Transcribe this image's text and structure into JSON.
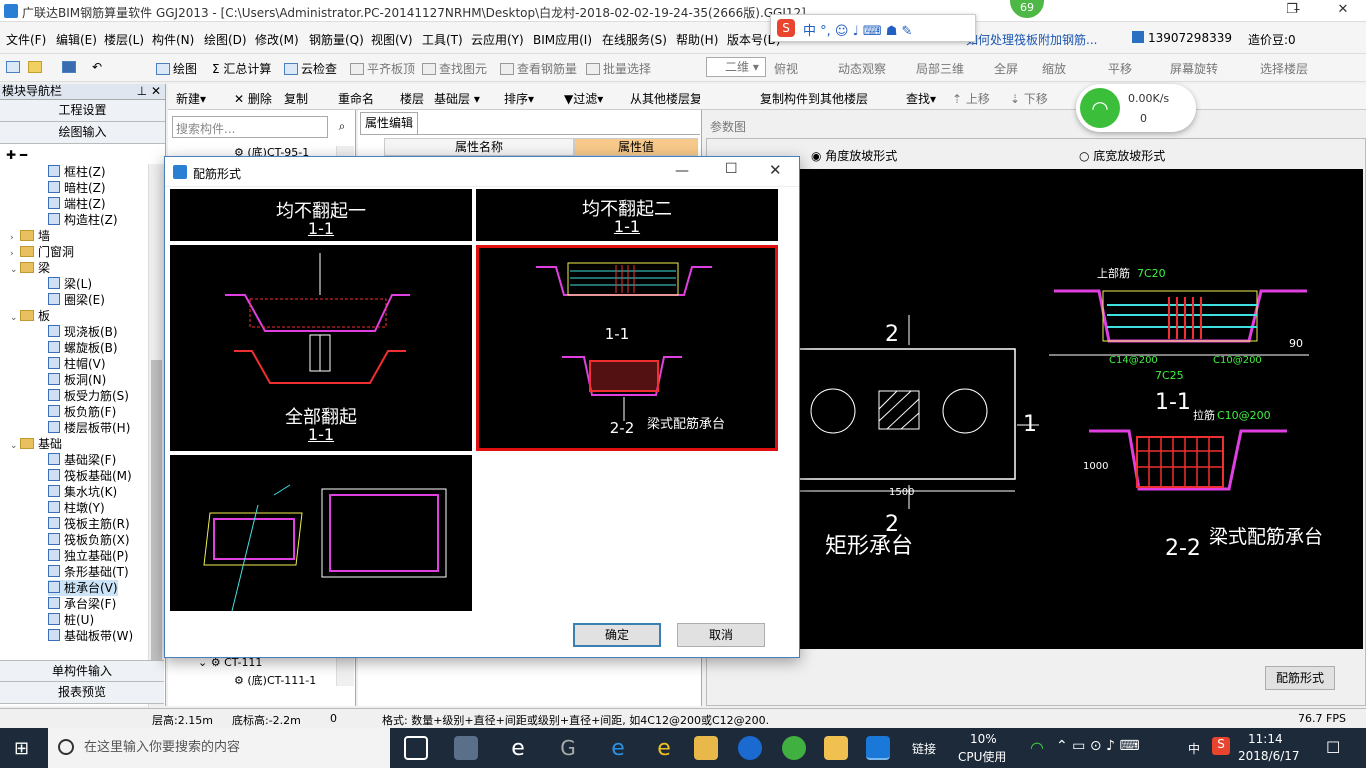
{
  "window": {
    "title": "广联达BIM钢筋算量软件 GGJ2013 - [C:\\Users\\Administrator.PC-20141127NRHM\\Desktop\\白龙村-2018-02-02-19-24-35(2666版).GGJ12]",
    "badge": "69"
  },
  "menu": [
    "文件(F)",
    "编辑(E)",
    "楼层(L)",
    "构件(N)",
    "绘图(D)",
    "修改(M)",
    "钢筋量(Q)",
    "视图(V)",
    "工具(T)",
    "云应用(Y)",
    "BIM应用(I)",
    "在线服务(S)",
    "帮助(H)",
    "版本号(B)"
  ],
  "menu_extra": {
    "notice": "如何处理筏板附加钢筋...",
    "phone": "13907298339",
    "beans": "造价豆:0"
  },
  "toolbar1": [
    "绘图",
    "汇总计算",
    "云检查",
    "平齐板顶",
    "查找图元",
    "查看钢筋量",
    "批量选择",
    "二维",
    "俯视",
    "动态观察",
    "局部三维",
    "全屏",
    "缩放",
    "平移",
    "屏幕旋转",
    "选择楼层"
  ],
  "nav": {
    "title": "模块导航栏",
    "btn_settings": "工程设置",
    "btn_draw": "绘图输入",
    "items": [
      {
        "label": "框柱(Z)",
        "indent": 2,
        "icon": "column-icon"
      },
      {
        "label": "暗柱(Z)",
        "indent": 2,
        "icon": "column-icon"
      },
      {
        "label": "端柱(Z)",
        "indent": 2,
        "icon": "column-icon"
      },
      {
        "label": "构造柱(Z)",
        "indent": 2,
        "icon": "column-icon"
      },
      {
        "label": "墙",
        "indent": 0,
        "icon": "folder-icon",
        "arrow": "›"
      },
      {
        "label": "门窗洞",
        "indent": 0,
        "icon": "folder-icon",
        "arrow": "›"
      },
      {
        "label": "梁",
        "indent": 0,
        "icon": "folder-icon",
        "arrow": "⌄"
      },
      {
        "label": "梁(L)",
        "indent": 2,
        "icon": "beam-icon"
      },
      {
        "label": "圈梁(E)",
        "indent": 2,
        "icon": "beam-icon"
      },
      {
        "label": "板",
        "indent": 0,
        "icon": "folder-icon",
        "arrow": "⌄"
      },
      {
        "label": "现浇板(B)",
        "indent": 2,
        "icon": "slab-icon"
      },
      {
        "label": "螺旋板(B)",
        "indent": 2,
        "icon": "slab-icon"
      },
      {
        "label": "柱帽(V)",
        "indent": 2,
        "icon": "slab-icon"
      },
      {
        "label": "板洞(N)",
        "indent": 2,
        "icon": "slab-icon"
      },
      {
        "label": "板受力筋(S)",
        "indent": 2,
        "icon": "slab-icon"
      },
      {
        "label": "板负筋(F)",
        "indent": 2,
        "icon": "slab-icon"
      },
      {
        "label": "楼层板带(H)",
        "indent": 2,
        "icon": "slab-icon"
      },
      {
        "label": "基础",
        "indent": 0,
        "icon": "folder-icon",
        "arrow": "⌄"
      },
      {
        "label": "基础梁(F)",
        "indent": 2,
        "icon": "foundation-icon"
      },
      {
        "label": "筏板基础(M)",
        "indent": 2,
        "icon": "foundation-icon"
      },
      {
        "label": "集水坑(K)",
        "indent": 2,
        "icon": "foundation-icon"
      },
      {
        "label": "柱墩(Y)",
        "indent": 2,
        "icon": "foundation-icon"
      },
      {
        "label": "筏板主筋(R)",
        "indent": 2,
        "icon": "foundation-icon"
      },
      {
        "label": "筏板负筋(X)",
        "indent": 2,
        "icon": "foundation-icon"
      },
      {
        "label": "独立基础(P)",
        "indent": 2,
        "icon": "foundation-icon"
      },
      {
        "label": "条形基础(T)",
        "indent": 2,
        "icon": "foundation-icon"
      },
      {
        "label": "桩承台(V)",
        "indent": 2,
        "icon": "foundation-icon",
        "selected": true
      },
      {
        "label": "承台梁(F)",
        "indent": 2,
        "icon": "foundation-icon"
      },
      {
        "label": "桩(U)",
        "indent": 2,
        "icon": "foundation-icon"
      },
      {
        "label": "基础板带(W)",
        "indent": 2,
        "icon": "foundation-icon"
      }
    ],
    "btn_single": "单构件输入",
    "btn_report": "报表预览"
  },
  "toolbar2": [
    "新建",
    "删除",
    "复制",
    "重命名",
    "楼层",
    "基础层",
    "排序",
    "过滤",
    "从其他楼层复制构件",
    "复制构件到其他楼层",
    "查找",
    "上移",
    "下移"
  ],
  "components": {
    "search_placeholder": "搜索构件...",
    "top_item": "(底)CT-95-1",
    "bottom_item1": "CT-111",
    "bottom_item2": "(底)CT-111-1"
  },
  "props": {
    "tab": "属性编辑",
    "col_name": "属性名称",
    "col_value": "属性值"
  },
  "param": {
    "header": "参数图",
    "radio1": "角度放坡形式",
    "radio2": "底宽放坡形式",
    "button": "配筋形式",
    "cad": {
      "title_rect": "矩形承台",
      "title_beam": "梁式配筋承台",
      "sec11": "1-1",
      "sec22": "2-2",
      "two": "2",
      "one": "1",
      "dim": "1500",
      "top_bar": "7C20",
      "bot_bar": "7C25",
      "side_bar": "C14@200",
      "stirrup": "C10@200",
      "tie": "C10@200",
      "height": "1000",
      "angle": "90"
    }
  },
  "dialog": {
    "title": "配筋形式",
    "tile1": "均不翻起一",
    "tile1_sec": "1-1",
    "tile2": "均不翻起二",
    "tile2_sec": "1-1",
    "tile3": "全部翻起",
    "tile3_sec": "1-1",
    "tile4_sec1": "1-1",
    "tile4_sec2": "2-2",
    "tile4_label": "梁式配筋承台",
    "ok": "确定",
    "cancel": "取消"
  },
  "wifi": {
    "speed": "0.00K/s",
    "count": "0"
  },
  "status": {
    "floor_height": "层高:2.15m",
    "bottom_height": "底标高:-2.2m",
    "zero": "0",
    "format": "格式: 数量+级别+直径+间距或级别+直径+间距, 如4C12@200或C12@200.",
    "fps": "76.7 FPS"
  },
  "taskbar": {
    "search": "在这里输入你要搜索的内容",
    "link": "链接",
    "cpu_pct": "10%",
    "cpu": "CPU使用",
    "lang": "中",
    "time": "11:14",
    "date": "2018/6/17"
  }
}
